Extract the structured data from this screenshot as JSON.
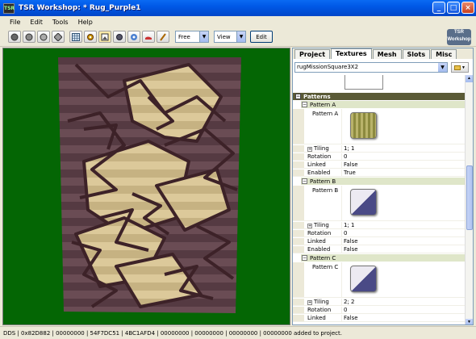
{
  "window": {
    "title": "TSR Workshop: * Rug_Purple1",
    "app_icon_text": "TSR",
    "minimize_label": "_",
    "maximize_label": "□",
    "close_label": "×"
  },
  "menu": [
    "File",
    "Edit",
    "Tools",
    "Help"
  ],
  "toolbar": {
    "view_mode": "Free",
    "view_label": "View",
    "edit_label": "Edit",
    "logo_text": "TSR Workshop",
    "buttons": [
      "sphere-dark-icon",
      "sphere-medium-icon",
      "sphere-light-icon",
      "diamond-icon",
      "grid-icon",
      "gear-icon",
      "picture-icon",
      "circle-icon",
      "settings-icon",
      "shoe-icon",
      "brush-icon"
    ]
  },
  "panel": {
    "tabs": [
      "Project",
      "Textures",
      "Mesh",
      "Slots",
      "Misc"
    ],
    "active_tab": "Textures",
    "texture_selector": "rugMissionSquare3X2",
    "category": "Patterns",
    "patterns": [
      {
        "header": "Pattern A",
        "name": "Pattern A",
        "tiling": "1; 1",
        "rotation": "0",
        "linked": "False",
        "enabled": "True",
        "swatch": "stripes"
      },
      {
        "header": "Pattern B",
        "name": "Pattern B",
        "tiling": "1; 1",
        "rotation": "0",
        "linked": "False",
        "enabled": "False",
        "swatch": "diagonal"
      },
      {
        "header": "Pattern C",
        "name": "Pattern C",
        "tiling": "2; 2",
        "rotation": "0",
        "linked": "False",
        "enabled": "False",
        "swatch": "diagonal"
      }
    ],
    "labels": {
      "tiling": "Tiling",
      "rotation": "Rotation",
      "linked": "Linked",
      "enabled": "Enabled"
    }
  },
  "colors": {
    "viewport_bg": "#046604",
    "rug_dark": "#5e4248",
    "rug_light": "#d8c392",
    "category_bg": "#5a5a36"
  },
  "status": "DDS | 0x82D882 | 00000000 | 54F7DC51 | 4BC1AFD4 | 00000000 | 00000000 | 00000000 | 00000000 added to project."
}
